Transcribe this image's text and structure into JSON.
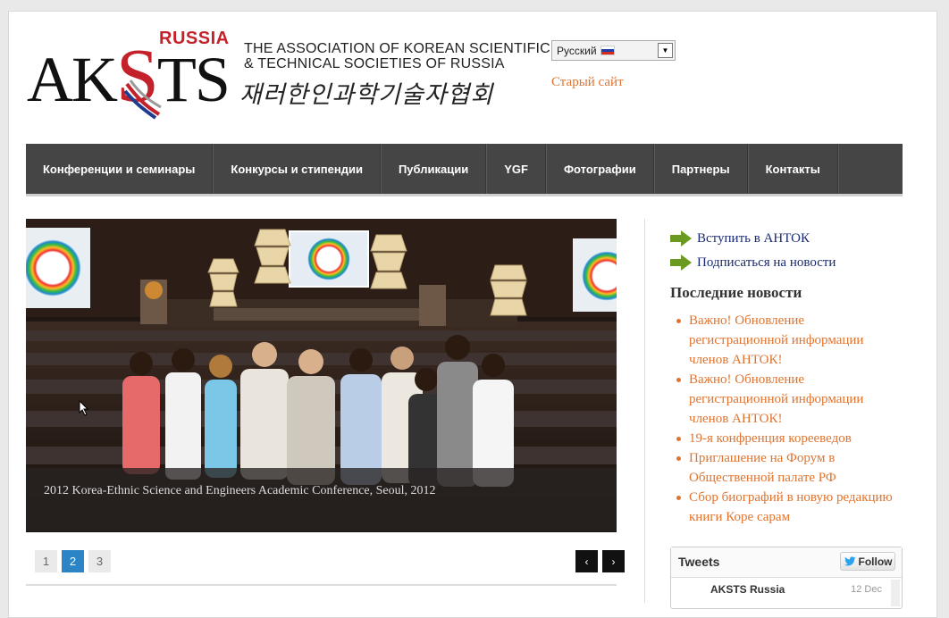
{
  "header": {
    "logo_russia": "RUSSIA",
    "logo_text_pre": "AK",
    "logo_text_s": "S",
    "logo_text_post": "TS",
    "assoc_line1": "THE ASSOCIATION OF KOREAN SCIENTIFIC",
    "assoc_line2": "& TECHNICAL SOCIETIES OF RUSSIA",
    "korean_name": "재러한인과학기술자협회",
    "language_selected": "Русский",
    "old_site_link": "Старый сайт"
  },
  "nav": {
    "items": [
      {
        "label": "Конференции и семинары"
      },
      {
        "label": "Конкурсы и стипендии"
      },
      {
        "label": "Публикации"
      },
      {
        "label": "YGF"
      },
      {
        "label": "Фотографии"
      },
      {
        "label": "Партнеры"
      },
      {
        "label": "Контакты"
      }
    ]
  },
  "slider": {
    "caption": "2012 Korea-Ethnic Science and Engineers Academic Conference, Seoul, 2012",
    "pages": [
      "1",
      "2",
      "3"
    ],
    "active_page": "2",
    "prev_icon": "‹",
    "next_icon": "›"
  },
  "sidebar": {
    "join_link": "Вступить в АНТОК",
    "subscribe_link": "Подписаться на новости",
    "news_title": "Последние новости",
    "news": [
      "Важно! Обновление регистрационной информации членов АНТОК!",
      "Важно! Обновление регистрационной информации членов АНТОК!",
      "19-я конфренция корееведов",
      "Приглашение на Форум в Общественной палате РФ",
      "Сбор биографий в новую редакцию книги Коре сарам"
    ],
    "tweets_title": "Tweets",
    "follow_label": "Follow",
    "tweet_author": "AKSTS Russia",
    "tweet_date": "12 Dec"
  },
  "colors": {
    "nav_bg": "#454545",
    "link_orange": "#e0742e",
    "link_navy": "#1a2a72",
    "pager_active": "#2b84c5",
    "logo_red": "#c4222a"
  }
}
